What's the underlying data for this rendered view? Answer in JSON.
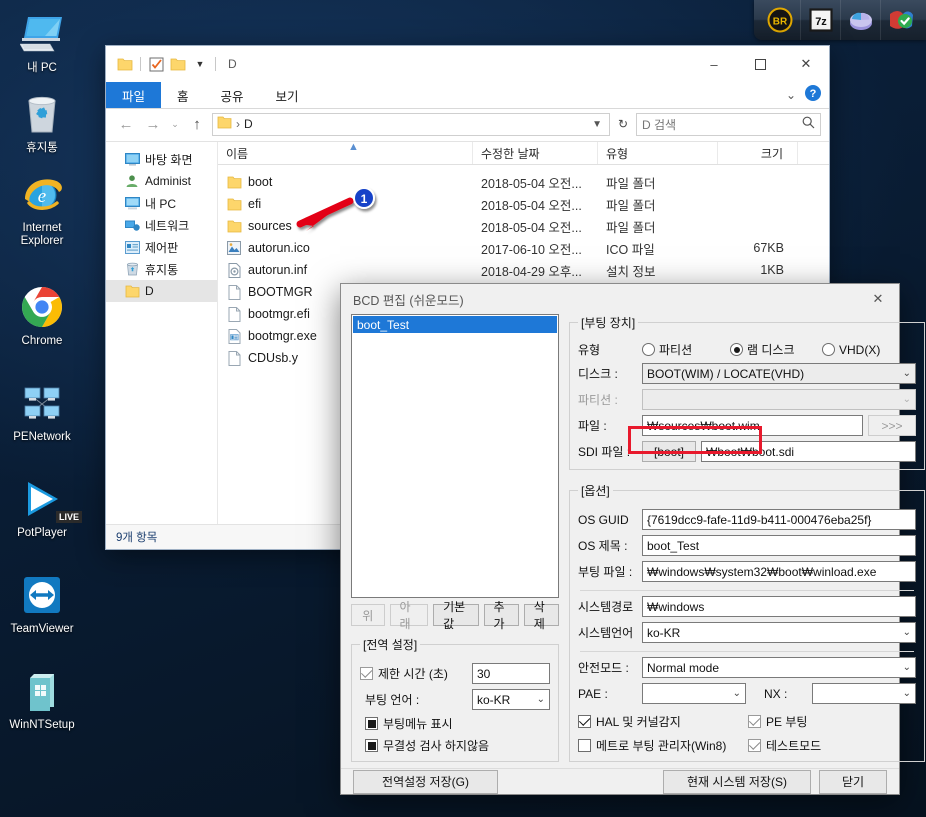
{
  "desktop": {
    "icons": [
      {
        "label": "내 PC",
        "icon": "computer-icon"
      },
      {
        "label": "휴지통",
        "icon": "recycle-bin-icon"
      },
      {
        "label": "Internet Explorer",
        "icon": "internet-explorer-icon"
      },
      {
        "label": "Chrome",
        "icon": "chrome-icon"
      },
      {
        "label": "PENetwork",
        "icon": "network-nodes-icon"
      },
      {
        "label": "PotPlayer",
        "icon": "potplayer-icon",
        "badge": "LIVE"
      },
      {
        "label": "TeamViewer",
        "icon": "teamviewer-icon"
      },
      {
        "label": "WinNTSetup",
        "icon": "winntsetup-icon"
      }
    ]
  },
  "tray": {
    "items": [
      {
        "name": "bandizip-icon",
        "label": "BR"
      },
      {
        "name": "sevenzip-icon",
        "label": "7z"
      },
      {
        "name": "defrag-pie-icon",
        "label": ""
      },
      {
        "name": "shield-check-icon",
        "label": ""
      }
    ]
  },
  "explorer": {
    "title": "D",
    "quick_access": [
      {
        "name": "qat-folder-icon"
      },
      {
        "name": "qat-properties-icon"
      },
      {
        "name": "qat-new-folder-icon"
      },
      {
        "name": "qat-dropdown-icon"
      }
    ],
    "window_controls": {
      "minimize": "‒",
      "maximize": "☐",
      "close": "✕"
    },
    "ribbon_tabs": [
      {
        "label": "파일",
        "active": true
      },
      {
        "label": "홈",
        "active": false
      },
      {
        "label": "공유",
        "active": false
      },
      {
        "label": "보기",
        "active": false
      }
    ],
    "ribbon_right": {
      "expand": "⌄",
      "help": "?"
    },
    "address": {
      "crumb_root": "D",
      "separator": "›",
      "value": "D"
    },
    "search": {
      "placeholder": "D 검색",
      "value": ""
    },
    "nav_buttons": {
      "back": "←",
      "forward": "→",
      "recent": "⌄",
      "up": "↑"
    },
    "nav_pane": [
      {
        "label": "바탕 화면",
        "icon": "desktop-icon",
        "selected": false
      },
      {
        "label": "Administ",
        "icon": "user-icon",
        "selected": false
      },
      {
        "label": "내 PC",
        "icon": "computer-icon",
        "selected": false
      },
      {
        "label": "네트워크",
        "icon": "network-icon",
        "selected": false
      },
      {
        "label": "제어판",
        "icon": "control-panel-icon",
        "selected": false
      },
      {
        "label": "휴지통",
        "icon": "recycle-bin-icon",
        "selected": false
      },
      {
        "label": "D",
        "icon": "drive-folder-icon",
        "selected": true
      }
    ],
    "columns": [
      "이름",
      "수정한 날짜",
      "유형",
      "크기"
    ],
    "files": [
      {
        "name": "boot",
        "date": "2018-05-04 오전...",
        "type": "파일 폴더",
        "size": "",
        "icon": "folder-icon"
      },
      {
        "name": "efi",
        "date": "2018-05-04 오전...",
        "type": "파일 폴더",
        "size": "",
        "icon": "folder-icon"
      },
      {
        "name": "sources",
        "date": "2018-05-04 오전...",
        "type": "파일 폴더",
        "size": "",
        "icon": "folder-icon"
      },
      {
        "name": "autorun.ico",
        "date": "2017-06-10 오전...",
        "type": "ICO 파일",
        "size": "67KB",
        "icon": "ico-file-icon"
      },
      {
        "name": "autorun.inf",
        "date": "2018-04-29 오후...",
        "type": "설치 정보",
        "size": "1KB",
        "icon": "inf-file-icon"
      },
      {
        "name": "BOOTMGR",
        "date": "",
        "type": "",
        "size": "",
        "icon": "generic-file-icon"
      },
      {
        "name": "bootmgr.efi",
        "date": "",
        "type": "",
        "size": "",
        "icon": "generic-file-icon"
      },
      {
        "name": "bootmgr.exe",
        "date": "",
        "type": "",
        "size": "",
        "icon": "exe-file-icon"
      },
      {
        "name": "CDUsb.y",
        "date": "",
        "type": "",
        "size": "",
        "icon": "generic-file-icon"
      }
    ],
    "status": "9개 항목"
  },
  "annotation": {
    "badge": "1",
    "color": "#e30613"
  },
  "bcd": {
    "title": "BCD 편집 (쉬운모드)",
    "close": "✕",
    "entries": [
      {
        "label": "boot_Test",
        "selected": true
      }
    ],
    "entry_buttons": [
      {
        "label": "위",
        "disabled": true
      },
      {
        "label": "아래",
        "disabled": true
      },
      {
        "label": "기본값",
        "disabled": false
      },
      {
        "label": "추가",
        "disabled": false
      },
      {
        "label": "삭제",
        "disabled": false
      }
    ],
    "global": {
      "legend": "[전역 설정]",
      "timeout_label": "제한 시간 (초)",
      "timeout_checked": true,
      "timeout_value": "30",
      "lang_label": "부팅 언어 :",
      "lang_value": "ko-KR",
      "show_menu_label": "부팅메뉴 표시",
      "show_menu_state": "indeterminate",
      "nointegrity_label": "무결성 검사 하지않음",
      "nointegrity_state": "indeterminate"
    },
    "boot_device": {
      "legend": "[부팅 장치]",
      "type_label": "유형",
      "type_options": [
        {
          "label": "파티션",
          "selected": false
        },
        {
          "label": "램 디스크",
          "selected": true
        },
        {
          "label": "VHD(X)",
          "selected": false
        }
      ],
      "disk_label": "디스크 :",
      "disk_value": "BOOT(WIM) / LOCATE(VHD)",
      "partition_label": "파티션 :",
      "partition_value": "",
      "partition_disabled": true,
      "file_label": "파일 :",
      "file_value": "₩sources₩boot.wim",
      "browse_label": ">>>",
      "browse_disabled": true,
      "sdi_label": "SDI 파일 :",
      "sdi_button": "[boot]",
      "sdi_value": "₩boot₩boot.sdi"
    },
    "options": {
      "legend": "[옵션]",
      "guid_label": "OS GUID",
      "guid_value": "{7619dcc9-fafe-11d9-b411-000476eba25f}",
      "ostitle_label": "OS 제목 :",
      "ostitle_value": "boot_Test",
      "bootfile_label": "부팅 파일 :",
      "bootfile_value": "₩windows₩system32₩boot₩winload.exe",
      "syspath_label": "시스템경로",
      "syspath_value": "₩windows",
      "syslang_label": "시스템언어",
      "syslang_value": "ko-KR",
      "safemode_label": "안전모드 :",
      "safemode_value": "Normal mode",
      "pae_label": "PAE :",
      "pae_value": "",
      "nx_label": "NX :",
      "nx_value": "",
      "checks": [
        {
          "label": "HAL 및 커널감지",
          "checked": true,
          "gray": false
        },
        {
          "label": "PE 부팅",
          "checked": true,
          "gray": true
        },
        {
          "label": "메트로 부팅 관리자(Win8)",
          "checked": false,
          "gray": false
        },
        {
          "label": "테스트모드",
          "checked": true,
          "gray": true
        }
      ]
    },
    "footer": {
      "save_global": "전역설정 저장(G)",
      "save_current": "현재 시스템 저장(S)",
      "close": "닫기"
    }
  }
}
